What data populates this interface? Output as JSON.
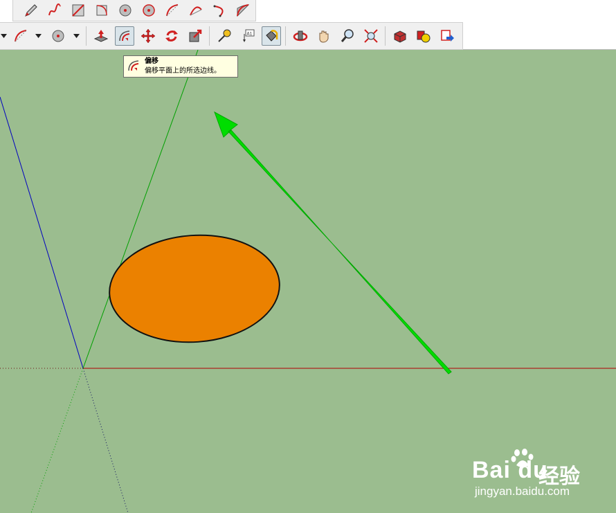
{
  "toolbar": {
    "row1_tools": [
      "pencil-icon",
      "freehand-icon",
      "rectangle-icon",
      "rotated-rectangle-icon",
      "circle-icon",
      "polygon-icon",
      "arc-icon",
      "two-point-arc-icon",
      "three-point-arc-icon",
      "pie-icon"
    ],
    "row2_tools": [
      "arc-dropdown-icon",
      "circle-dropdown-icon",
      "push-pull-icon",
      "offset-icon",
      "move-icon",
      "rotate-icon",
      "scale-icon",
      "tape-measure-icon",
      "text-icon",
      "paint-bucket-icon",
      "orbit-icon",
      "pan-icon",
      "zoom-icon",
      "zoom-extents-icon",
      "components-icon",
      "materials-icon",
      "export-icon"
    ],
    "active_tool": "offset"
  },
  "tooltip": {
    "title": "偏移",
    "description": "偏移平面上的所选边线。"
  },
  "canvas": {
    "background": "#9bbd8f",
    "shape_fill": "#eb8100",
    "arrow_color": "#00e000",
    "axis_red": "#b00000",
    "axis_green": "#00b000",
    "axis_blue": "#0000c0"
  },
  "watermark": {
    "logo": "Bai du",
    "brand": "经验",
    "url": "jingyan.baidu.com"
  }
}
